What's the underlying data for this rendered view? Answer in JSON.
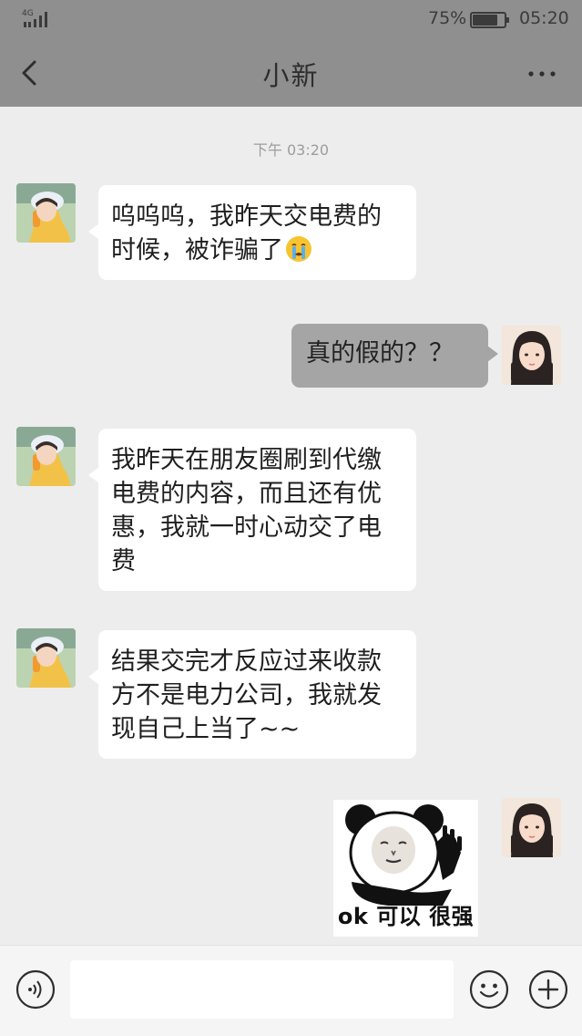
{
  "status_bar": {
    "network": "4G",
    "battery_percent": "75%",
    "battery_level": 0.75,
    "time": "05:20"
  },
  "nav": {
    "back_icon": "chevron-left-icon",
    "title": "小新",
    "more_icon": "more-dots-icon"
  },
  "chat": {
    "timestamp": "下午 03:20",
    "messages": [
      {
        "side": "left",
        "text": "呜呜呜，我昨天交电费的时候，被诈骗了",
        "emoji": "crying-face-emoji"
      },
      {
        "side": "right",
        "text": "真的假的？？"
      },
      {
        "side": "left",
        "text": "我昨天在朋友圈刷到代缴电费的内容，而且还有优惠，我就一时心动交了电费"
      },
      {
        "side": "left",
        "text": "结果交完才反应过来收款方不是电力公司，我就发现自己上当了~~"
      },
      {
        "side": "right",
        "type": "sticker",
        "sticker_icon": "panda-meme-sticker",
        "caption": "ok 可以 很强"
      }
    ]
  },
  "input_bar": {
    "voice_icon": "voice-icon",
    "input_value": "",
    "emoji_icon": "smiley-icon",
    "plus_icon": "plus-icon"
  },
  "colors": {
    "header_bg": "#8f8f8f",
    "chat_bg": "#ededed",
    "bubble_left": "#ffffff",
    "bubble_right": "#a5a5a5",
    "input_bar_bg": "#f5f5f5"
  }
}
